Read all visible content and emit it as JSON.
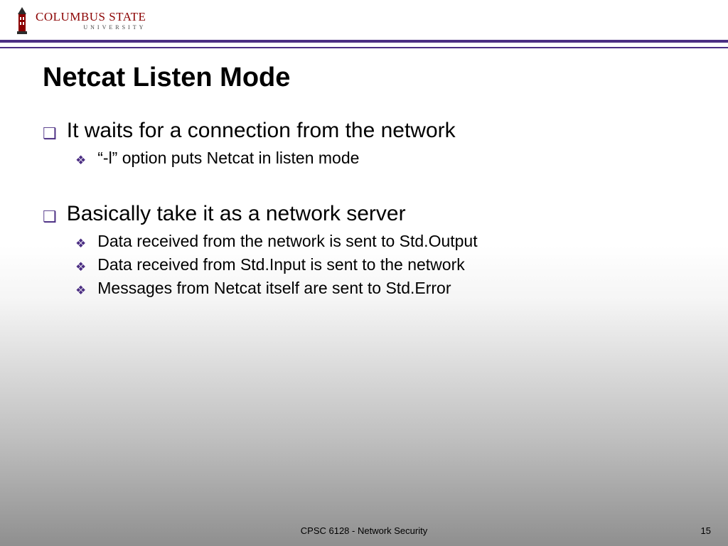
{
  "header": {
    "logo_top": "COLUMBUS STATE",
    "logo_sub": "UNIVERSITY"
  },
  "title": "Netcat Listen Mode",
  "points": [
    {
      "text": "It waits for a connection from the network",
      "sub": [
        "“-l” option puts Netcat in listen mode"
      ]
    },
    {
      "text": "Basically take it as a network server",
      "sub": [
        "Data received from the network is sent to Std.Output",
        "Data received from Std.Input is sent to the network",
        "Messages from Netcat itself are sent to Std.Error"
      ]
    }
  ],
  "footer": "CPSC 6128 - Network Security",
  "page": "15"
}
